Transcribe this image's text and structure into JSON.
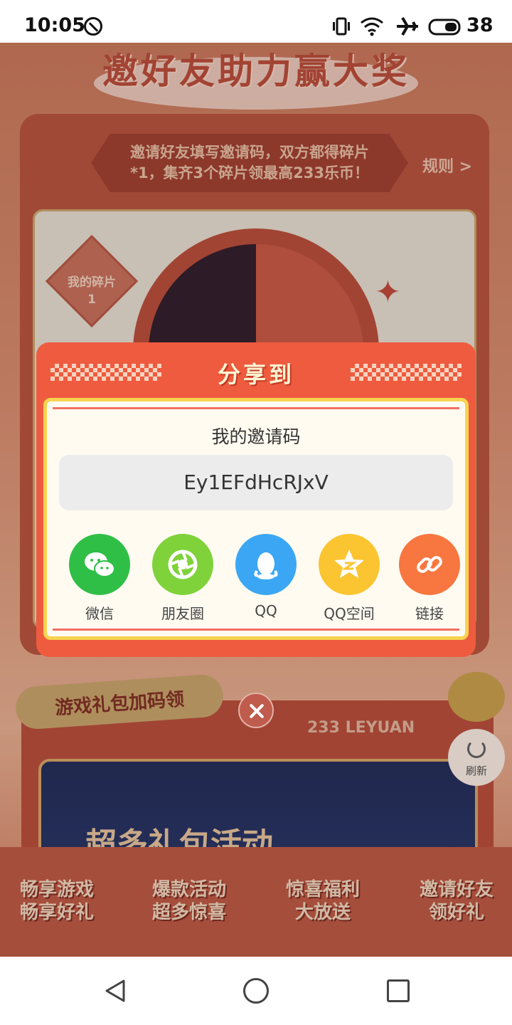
{
  "status_bar": {
    "time": "10:05",
    "battery": "38"
  },
  "page": {
    "hero_title": "邀好友助力赢大奖",
    "banner_line1": "邀请好友填写邀请码，双方都得碎片",
    "banner_line2": "*1，集齐3个碎片领最高233乐币！",
    "rules": "规则 >",
    "piece_label": "我的碎片",
    "piece_count": "1",
    "gift_title": "游戏礼包加码领",
    "gift_brand": "233 LEYUAN",
    "gift_banner_text": "超多礼包活动",
    "features": [
      {
        "line1": "畅享游戏",
        "line2": "畅享好礼"
      },
      {
        "line1": "爆款活动",
        "line2": "超多惊喜"
      },
      {
        "line1": "惊喜福利",
        "line2": "大放送"
      },
      {
        "line1": "邀请好友",
        "line2": "领好礼"
      }
    ],
    "refresh_label": "刷新"
  },
  "modal": {
    "title": "分享到",
    "code_label": "我的邀请码",
    "invite_code": "Ey1EFdHcRJxV",
    "share_options": [
      {
        "label": "微信",
        "icon": "wechat-icon",
        "color": "#2fbf47"
      },
      {
        "label": "朋友圈",
        "icon": "moments-icon",
        "color": "#7fd23a"
      },
      {
        "label": "QQ",
        "icon": "qq-icon",
        "color": "#3ba7f4"
      },
      {
        "label": "QQ空间",
        "icon": "qzone-icon",
        "color": "#fbc531"
      },
      {
        "label": "链接",
        "icon": "link-icon",
        "color": "#f8763f"
      }
    ]
  }
}
